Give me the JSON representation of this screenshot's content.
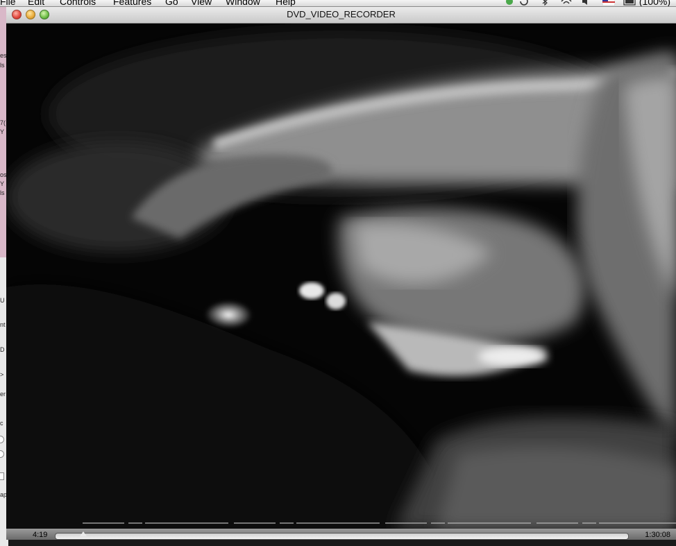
{
  "menubar": {
    "items": [
      "File",
      "Edit",
      "Controls",
      "Features",
      "Go",
      "View",
      "Window",
      "Help"
    ],
    "battery": "(100%)"
  },
  "desktop": {
    "fragments": [
      "es",
      "ls",
      "7(",
      "Y",
      "os",
      "Y",
      "ls",
      "U",
      "nt",
      "D",
      ">",
      "er",
      "c",
      "ap"
    ]
  },
  "window": {
    "title": "DVD_VIDEO_RECORDER"
  },
  "controller": {
    "elapsed": "4:19",
    "total": "1:30:08",
    "progress": 0.048
  }
}
